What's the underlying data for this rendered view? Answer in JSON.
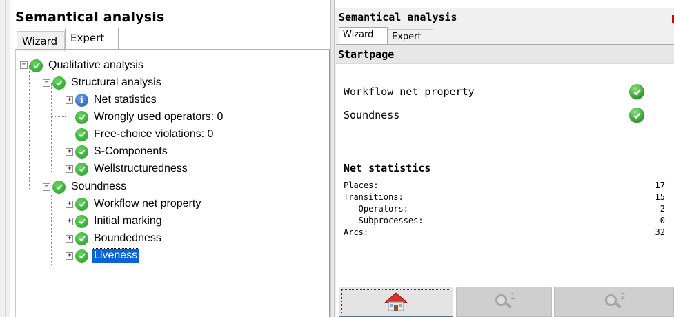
{
  "left": {
    "title": "Semantical analysis",
    "tabs": {
      "wizard": "Wizard",
      "expert": "Expert"
    },
    "active_tab": "Expert",
    "tree": {
      "root": "Qualitative analysis",
      "structural": "Structural analysis",
      "net_statistics": "Net statistics",
      "wrongly_used_operators": "Wrongly used operators: 0",
      "free_choice_violations": "Free-choice violations: 0",
      "s_components": "S-Components",
      "wellstructuredness": "Wellstructuredness",
      "soundness": "Soundness",
      "workflow_net_property": "Workflow net property",
      "initial_marking": "Initial marking",
      "boundedness": "Boundedness",
      "liveness": "Liveness"
    },
    "selected_item": "Liveness"
  },
  "right": {
    "title": "Semantical analysis",
    "tabs": {
      "wizard": "Wizard",
      "expert": "Expert"
    },
    "active_tab": "Wizard",
    "page_header": "Startpage",
    "properties": [
      {
        "label": "Workflow net property",
        "status": "ok"
      },
      {
        "label": "Soundness",
        "status": "ok"
      }
    ],
    "net_statistics": {
      "title": "Net statistics",
      "rows": [
        {
          "label": "Places:",
          "value": "17"
        },
        {
          "label": "Transitions:",
          "value": "15"
        },
        {
          "label": " - Operators:",
          "value": "2"
        },
        {
          "label": " - Subprocesses:",
          "value": "0"
        },
        {
          "label": "Arcs:",
          "value": "32"
        }
      ]
    },
    "nav_buttons": [
      {
        "icon": "home-icon"
      },
      {
        "icon": "magnifier-icon",
        "badge": "1"
      },
      {
        "icon": "magnifier-icon",
        "badge": "2"
      }
    ]
  },
  "colors": {
    "ok_green": "#2a9a2e",
    "info_blue": "#1f54b6",
    "selection_blue": "#0a64d8"
  }
}
